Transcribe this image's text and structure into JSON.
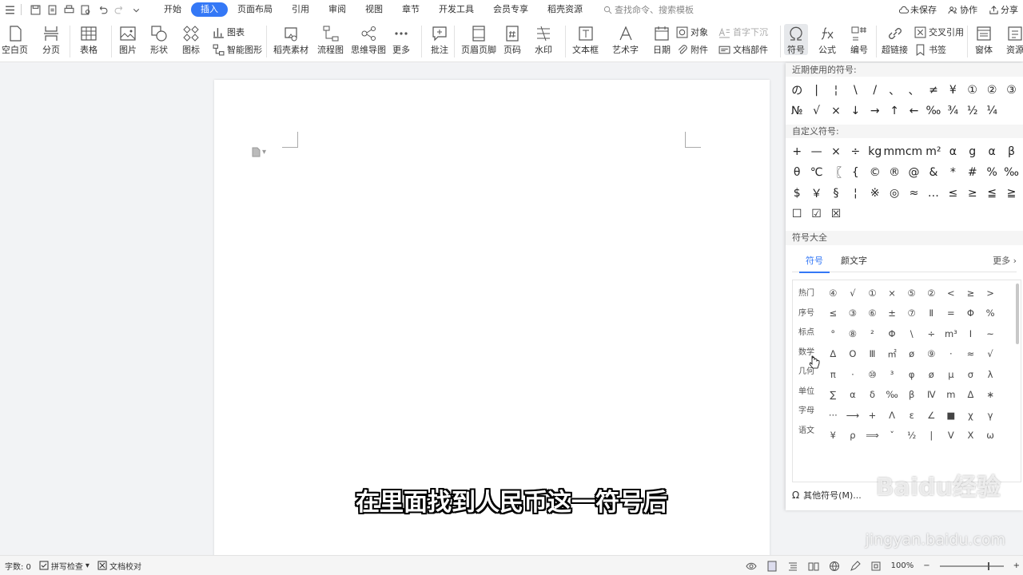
{
  "menu": {
    "tabs": [
      "开始",
      "插入",
      "页面布局",
      "引用",
      "审阅",
      "视图",
      "章节",
      "开发工具",
      "会员专享",
      "稻壳资源"
    ],
    "active_tab": "插入",
    "search_placeholder": "查找命令、搜索模板",
    "unsaved": "未保存",
    "collab": "协作",
    "share": "分享"
  },
  "ribbon": {
    "blank_page": "空白页",
    "page_break": "分页",
    "table": "表格",
    "picture": "图片",
    "shape": "形状",
    "icon": "图标",
    "chart": "图表",
    "smart_shape": "智能图形",
    "docer_material": "稻壳素材",
    "flowchart": "流程图",
    "mindmap": "思维导图",
    "more": "更多",
    "comment": "批注",
    "header_footer": "页眉页脚",
    "page_number": "页码",
    "watermark": "水印",
    "textbox": "文本框",
    "wordart": "艺术字",
    "date": "日期",
    "object": "对象",
    "attachment": "附件",
    "drop_cap": "首字下沉",
    "doc_parts": "文档部件",
    "symbol": "符号",
    "formula": "公式",
    "numbering": "编号",
    "hyperlink": "超链接",
    "cross_ref": "交叉引用",
    "bookmark": "书签",
    "window": "窗体",
    "resources": "资源"
  },
  "panel": {
    "recent_title": "近期使用的符号:",
    "recent": [
      "の",
      "|",
      "¦",
      "\\",
      "/",
      "、",
      "、",
      "≠",
      "¥",
      "①",
      "②",
      "③",
      "№",
      "√",
      "×",
      "↓",
      "→",
      "↑",
      "←",
      "‰",
      "¾",
      "½",
      "¼"
    ],
    "custom_title": "自定义符号:",
    "custom": [
      "+",
      "—",
      "×",
      "÷",
      "kg",
      "mm",
      "cm",
      "m²",
      "α",
      "g",
      "α",
      "β",
      "θ",
      "℃",
      "〖",
      "{",
      "©",
      "®",
      "@",
      "&",
      "*",
      "#",
      "%",
      "‰",
      "$",
      "￥",
      "§",
      "¦",
      "※",
      "◎",
      "≈",
      "…",
      "≤",
      "≥",
      "≦",
      "≧",
      "☐",
      "☑",
      "☒"
    ],
    "all_title": "符号大全",
    "tab_symbol": "符号",
    "tab_emoticon": "颜文字",
    "more": "更多",
    "categories": [
      "热门",
      "序号",
      "标点",
      "数学",
      "几何",
      "单位",
      "字母",
      "语文"
    ],
    "symbols": [
      "④",
      "√",
      "①",
      "×",
      "⑤",
      "②",
      "<",
      "≥",
      ">",
      "≤",
      "③",
      "⑥",
      "±",
      "⑦",
      "Ⅱ",
      "=",
      "Φ",
      "%",
      "°",
      "⑧",
      "²",
      "Φ",
      "\\",
      "÷",
      "m³",
      "Ⅰ",
      "~",
      "Δ",
      "O",
      "Ⅲ",
      "㎡",
      "ø",
      "⑨",
      "·",
      "≈",
      "√",
      "π",
      "·",
      "⑩",
      "³",
      "φ",
      "ø",
      "μ",
      "σ",
      "λ",
      "∑",
      "α",
      "δ",
      "‰",
      "β",
      "Ⅳ",
      "m",
      "Δ",
      "∗",
      "···",
      "⟶",
      "+",
      "Λ",
      "ε",
      "∠",
      "■",
      "χ",
      "γ",
      "¥",
      "ρ",
      "⟹",
      "ˇ",
      "½",
      "|",
      "V",
      "X",
      "ω"
    ],
    "other_symbols": "其他符号(M)..."
  },
  "subtitle": "在里面找到人民币这一符号后",
  "watermark": {
    "brand": "Baidu经验",
    "url": "jingyan.baidu.com"
  },
  "status": {
    "word_count": "字数: 0",
    "spell_check": "拼写检查",
    "proofread": "文档校对",
    "zoom": "100%"
  }
}
